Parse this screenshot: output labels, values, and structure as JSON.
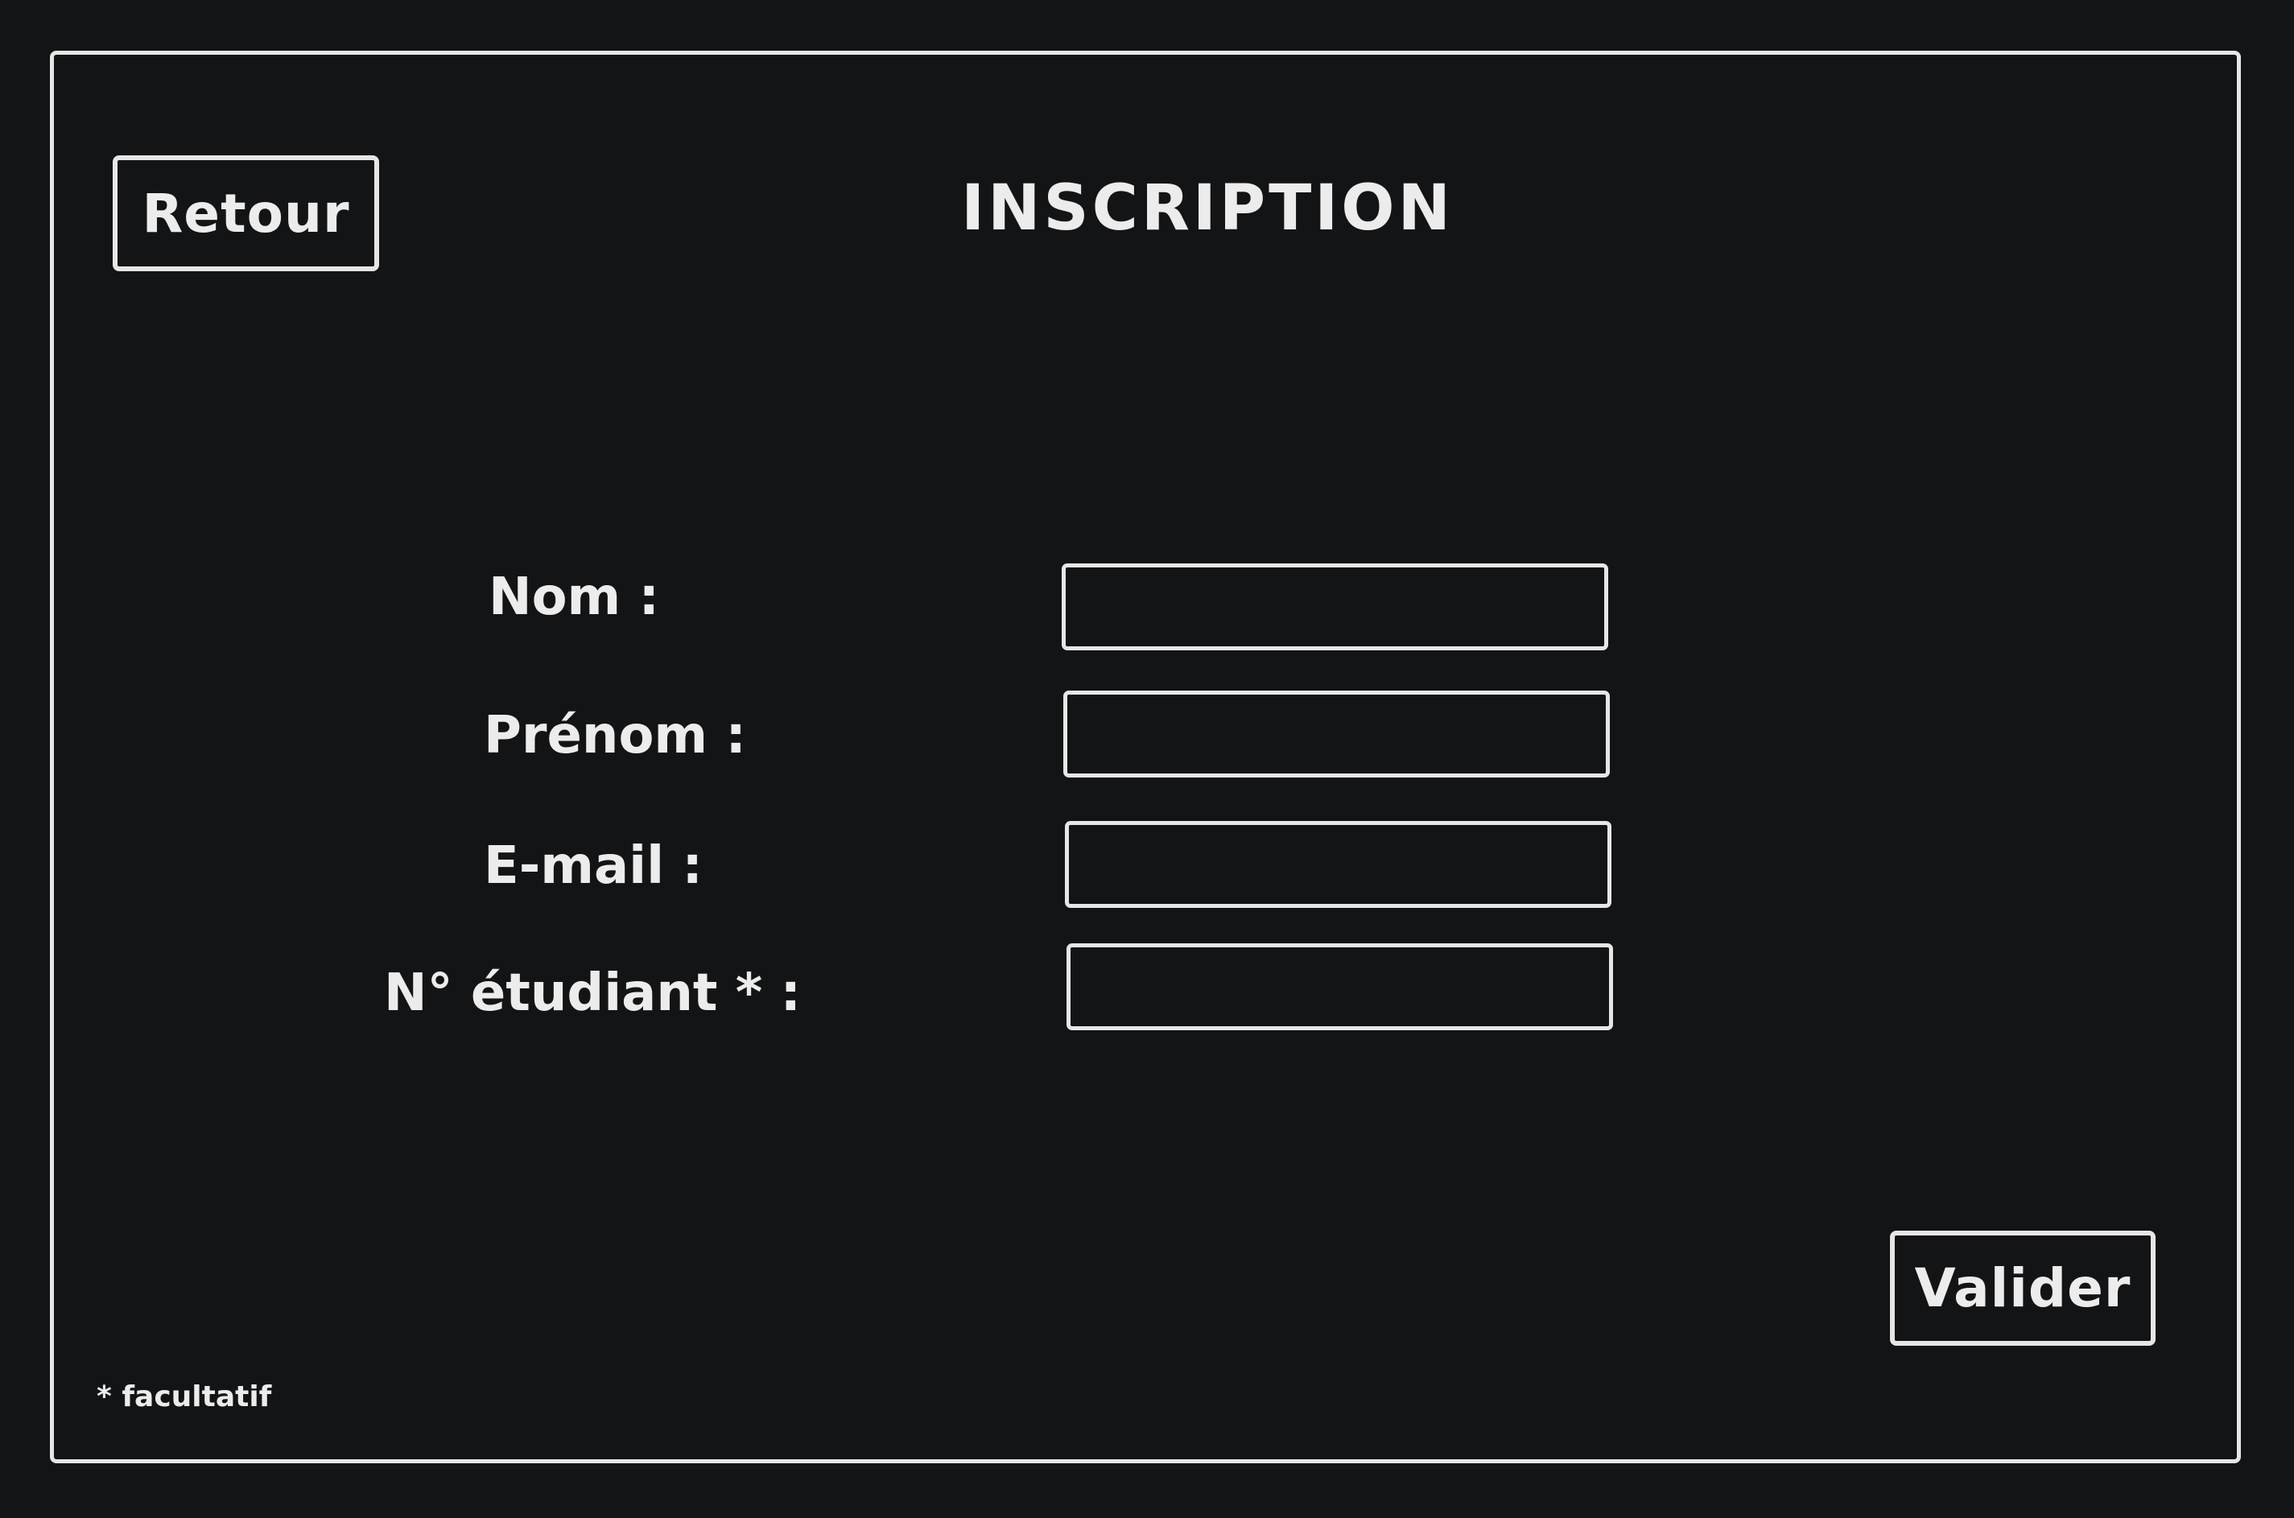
{
  "page": {
    "title": "INSCRIPTION",
    "back_label": "Retour",
    "submit_label": "Valider",
    "footnote": "* facultatif"
  },
  "form": {
    "fields": [
      {
        "label": "Nom :",
        "value": ""
      },
      {
        "label": "Prénom :",
        "value": ""
      },
      {
        "label": "E-mail :",
        "value": ""
      },
      {
        "label": "N° étudiant * :",
        "value": ""
      }
    ]
  },
  "colors": {
    "background": "#131416",
    "foreground": "#e6e6e6"
  }
}
